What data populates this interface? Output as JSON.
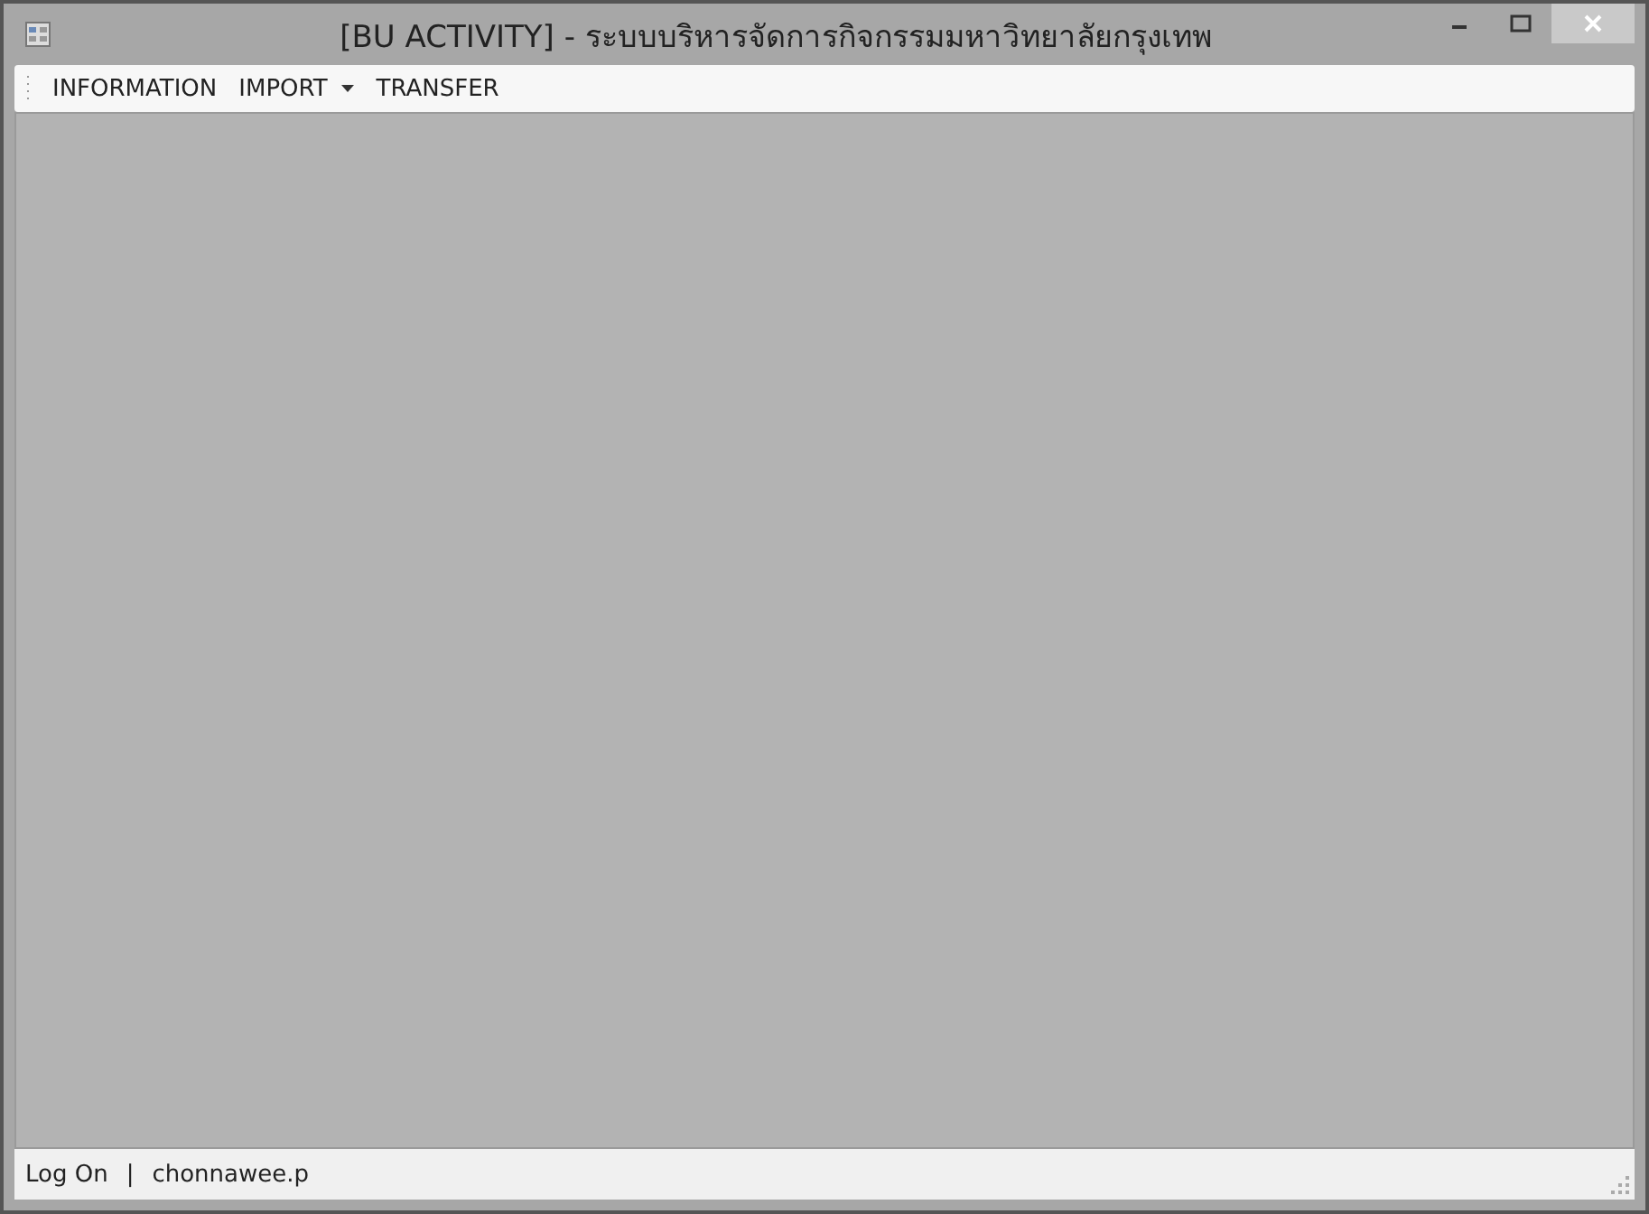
{
  "window": {
    "title": "[BU ACTIVITY] - ระบบบริหารจัดการกิจกรรมมหาวิทยาลัยกรุงเทพ"
  },
  "menu": [
    {
      "label": "INFORMATION",
      "kind": "plain"
    },
    {
      "label": "IMPORT",
      "kind": "dropdown"
    },
    {
      "label": "TRANSFER",
      "kind": "plain"
    }
  ],
  "status_bar": [
    "Log On",
    "|",
    "chonnawee.p"
  ]
}
